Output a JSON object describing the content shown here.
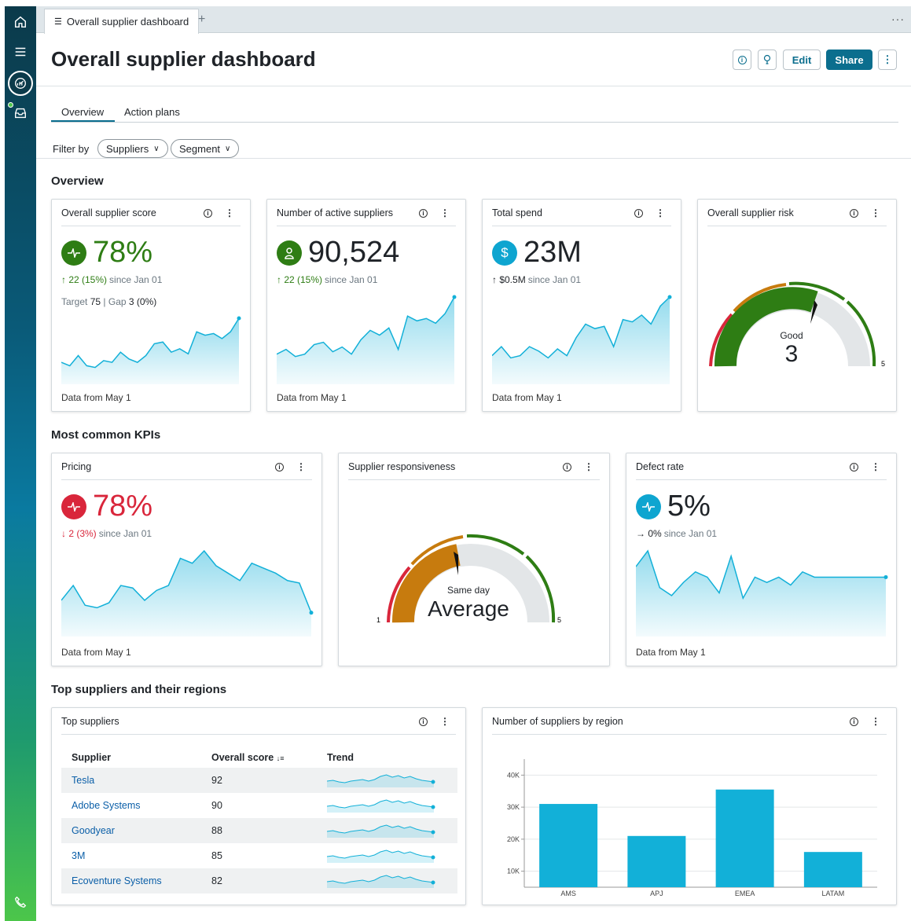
{
  "app": {
    "tab_label": "Overall supplier dashboard",
    "page_title": "Overall supplier dashboard",
    "buttons": {
      "edit": "Edit",
      "share": "Share"
    }
  },
  "tabs": [
    "Overview",
    "Action plans"
  ],
  "filters": {
    "label": "Filter by",
    "items": [
      "Suppliers",
      "Segment"
    ]
  },
  "sections": {
    "overview": "Overview",
    "kpis": "Most common KPIs",
    "top": "Top suppliers and their regions"
  },
  "cards": {
    "score": {
      "title": "Overall supplier score",
      "value": "78%",
      "delta_num": "↑ 22 (15%)",
      "delta_text": "since Jan 01",
      "target_label": "Target",
      "target_value": "75",
      "gap_label": "Gap",
      "gap_value": "3 (0%)",
      "footer": "Data from May 1",
      "badge_color": "#2e7d14",
      "value_color": "#2e7d14",
      "delta_color": "#2e7d14",
      "icon": "pulse-icon"
    },
    "active": {
      "title": "Number of active suppliers",
      "value": "90,524",
      "delta_num": "↑ 22 (15%)",
      "delta_text": "since Jan 01",
      "footer": "Data from May 1",
      "badge_color": "#2e7d14",
      "value_color": "#1f2328",
      "delta_color": "#2e7d14",
      "icon": "person-icon"
    },
    "spend": {
      "title": "Total spend",
      "value": "23M",
      "delta_num": "↑ $0.5M",
      "delta_text": "since Jan 01",
      "footer": "Data from May 1",
      "badge_color": "#0ea5d0",
      "value_color": "#1f2328",
      "delta_color": "#1f2328",
      "icon": "dollar-icon"
    },
    "risk": {
      "title": "Overall supplier risk",
      "gauge_label": "Good",
      "gauge_value": "3",
      "scale_max": "5",
      "level": 3
    },
    "pricing": {
      "title": "Pricing",
      "value": "78%",
      "delta_num": "↓ 2 (3%)",
      "delta_text": "since Jan 01",
      "footer": "Data from May 1",
      "badge_color": "#d9263b",
      "value_color": "#d9263b",
      "delta_color": "#d9263b",
      "icon": "pulse-icon"
    },
    "responsiveness": {
      "title": "Supplier responsiveness",
      "gauge_label": "Same day",
      "gauge_value": "Average",
      "scale_min": "1",
      "scale_max": "5",
      "level": 2
    },
    "defect": {
      "title": "Defect rate",
      "value": "5%",
      "delta_num": "→ 0%",
      "delta_text": "since Jan 01",
      "footer": "Data from May 1",
      "badge_color": "#0ea5d0",
      "value_color": "#1f2328",
      "delta_color": "#1f2328",
      "icon": "pulse-icon"
    },
    "top_suppliers": {
      "title": "Top suppliers",
      "columns": [
        "Supplier",
        "Overall score",
        "Trend"
      ],
      "rows": [
        {
          "name": "Tesla",
          "score": "92"
        },
        {
          "name": "Adobe Systems",
          "score": "90"
        },
        {
          "name": "Goodyear",
          "score": "88"
        },
        {
          "name": "3M",
          "score": "85"
        },
        {
          "name": "Ecoventure Systems",
          "score": "82"
        }
      ]
    },
    "region": {
      "title": "Number of suppliers by region"
    }
  },
  "chart_data": {
    "type": "bar",
    "categories": [
      "AMS",
      "APJ",
      "EMEA",
      "LATAM"
    ],
    "values": [
      31000,
      21000,
      35500,
      16000
    ],
    "yticks": [
      "10K",
      "20K",
      "30K",
      "40K"
    ],
    "ylim": [
      5000,
      45000
    ],
    "grid": true,
    "color": "#12b0d8"
  },
  "sparklines": {
    "score": [
      12,
      10,
      16,
      10,
      9,
      13,
      12,
      18,
      14,
      12,
      16,
      23,
      24,
      18,
      20,
      17,
      30,
      28,
      29,
      26,
      30,
      38
    ],
    "active": [
      12,
      14,
      11,
      12,
      16,
      17,
      13,
      15,
      12,
      18,
      22,
      20,
      23,
      14,
      28,
      26,
      27,
      25,
      29,
      36
    ],
    "spend": [
      12,
      16,
      11,
      12,
      16,
      14,
      11,
      15,
      12,
      20,
      26,
      24,
      25,
      16,
      28,
      27,
      30,
      26,
      34,
      38
    ],
    "pricing": [
      14,
      20,
      12,
      11,
      13,
      20,
      19,
      14,
      18,
      20,
      31,
      29,
      34,
      28,
      25,
      22,
      29,
      27,
      25,
      22,
      21,
      9
    ],
    "defect": [
      26,
      32,
      18,
      15,
      20,
      24,
      22,
      16,
      30,
      14,
      22,
      20,
      22,
      19,
      24,
      22,
      22,
      22,
      22,
      22,
      22,
      22
    ]
  }
}
